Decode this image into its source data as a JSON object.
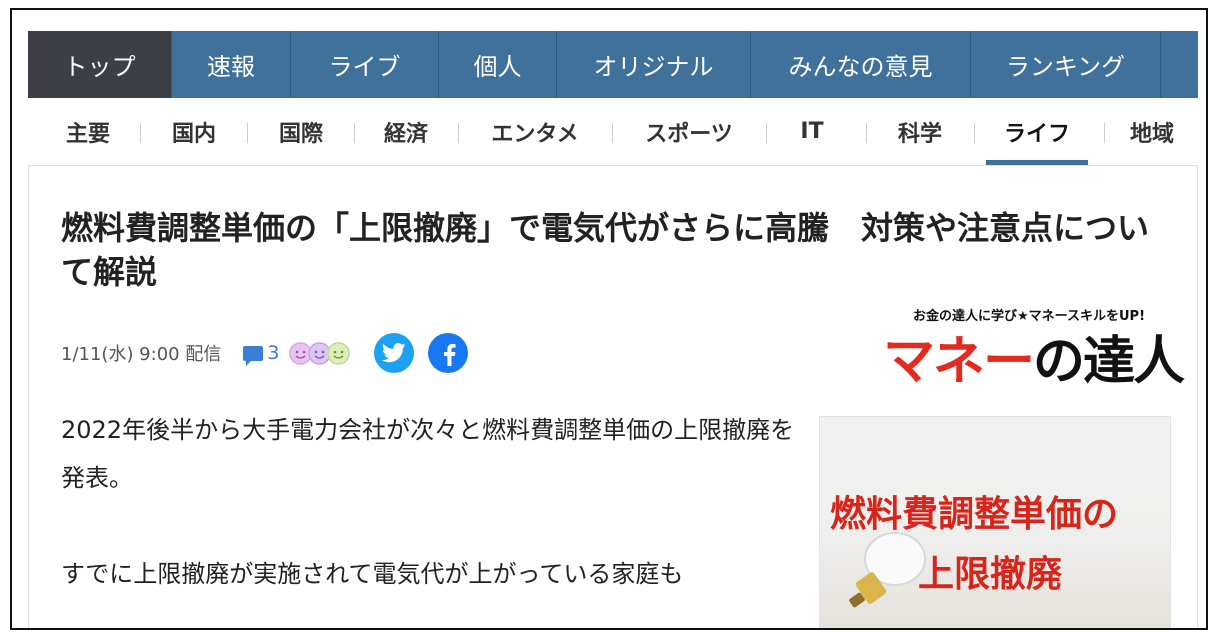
{
  "top_nav": [
    "トップ",
    "速報",
    "ライブ",
    "個人",
    "オリジナル",
    "みんなの意見",
    "ランキング"
  ],
  "sub_nav": [
    "主要",
    "国内",
    "国際",
    "経済",
    "エンタメ",
    "スポーツ",
    "IT",
    "科学",
    "ライフ",
    "地域"
  ],
  "article": {
    "title": "燃料費調整単価の「上限撤廃」で電気代がさらに高騰　対策や注意点について解説",
    "date": "1/11(水) 9:00 配信",
    "comment_count": "3",
    "body": [
      "2022年後半から大手電力会社が次々と燃料費調整単価の上限撤廃を発表。",
      "すでに上限撤廃が実施されて電気代が上がっている家庭も"
    ]
  },
  "logo": {
    "tagline": "お金の達人に学び★マネースキルをUP!",
    "name_red": "マネー",
    "name_dark": "の達人"
  },
  "thumbnail": {
    "line1": "燃料費調整単価の",
    "line2": "上限撤廃"
  },
  "colors": {
    "nav_bg": "#40719a",
    "nav_active": "#3c3f45",
    "twitter": "#1da1f2",
    "facebook": "#1877f2",
    "logo_red": "#e42a1f"
  }
}
